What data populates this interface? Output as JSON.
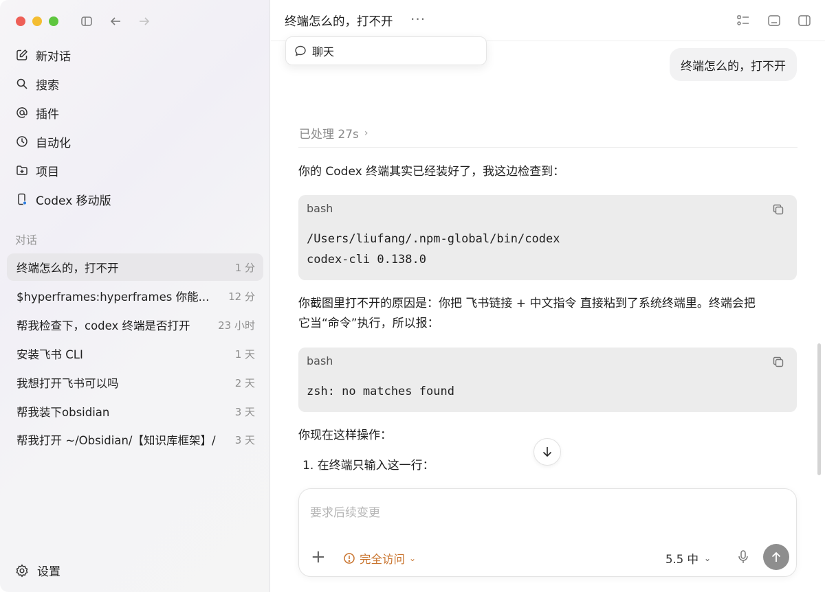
{
  "sidebar": {
    "nav": [
      {
        "label": "新对话",
        "icon": "compose-icon"
      },
      {
        "label": "搜索",
        "icon": "search-icon"
      },
      {
        "label": "插件",
        "icon": "at-icon"
      },
      {
        "label": "自动化",
        "icon": "clock-icon"
      },
      {
        "label": "项目",
        "icon": "folder-add-icon"
      },
      {
        "label": "Codex 移动版",
        "icon": "phone-icon"
      }
    ],
    "section_label": "对话",
    "conversations": [
      {
        "title": "终端怎么的，打不开",
        "time": "1 分"
      },
      {
        "title": "$hyperframes:hyperframes 你能...",
        "time": "12 分"
      },
      {
        "title": "帮我检查下，codex 终端是否打开",
        "time": "23 小时"
      },
      {
        "title": "安装飞书 CLI",
        "time": "1 天"
      },
      {
        "title": "我想打开飞书可以吗",
        "time": "2 天"
      },
      {
        "title": "帮我装下obsidian",
        "time": "3 天"
      },
      {
        "title": "帮我打开 ~/Obsidian/【知识库框架】/",
        "time": "3 天"
      }
    ],
    "settings_label": "设置"
  },
  "header": {
    "title": "终端怎么的，打不开",
    "more": "···"
  },
  "popover": {
    "label": "聊天"
  },
  "chat": {
    "user_message": "终端怎么的，打不开",
    "processed": "已处理 27s",
    "para1": "你的 Codex 终端其实已经装好了，我这边检查到：",
    "code1": {
      "lang": "bash",
      "line1": "/Users/liufang/.npm-global/bin/codex",
      "line2": "codex-cli 0.138.0"
    },
    "para2_line1": "你截图里打不开的原因是：你把 飞书链接 + 中文指令 直接粘到了系统终端里。终端会把",
    "para2_line2": "它当“命令”执行，所以报：",
    "code2": {
      "lang": "bash",
      "line1": "zsh: no matches found"
    },
    "para3": "你现在这样操作：",
    "list1": "1.  在终端只输入这一行："
  },
  "composer": {
    "placeholder": "要求后续变更",
    "access_label": "完全访问",
    "model_label": "5.5  中"
  },
  "colors": {
    "access": "#c9742e",
    "send": "#8e8e8e"
  }
}
